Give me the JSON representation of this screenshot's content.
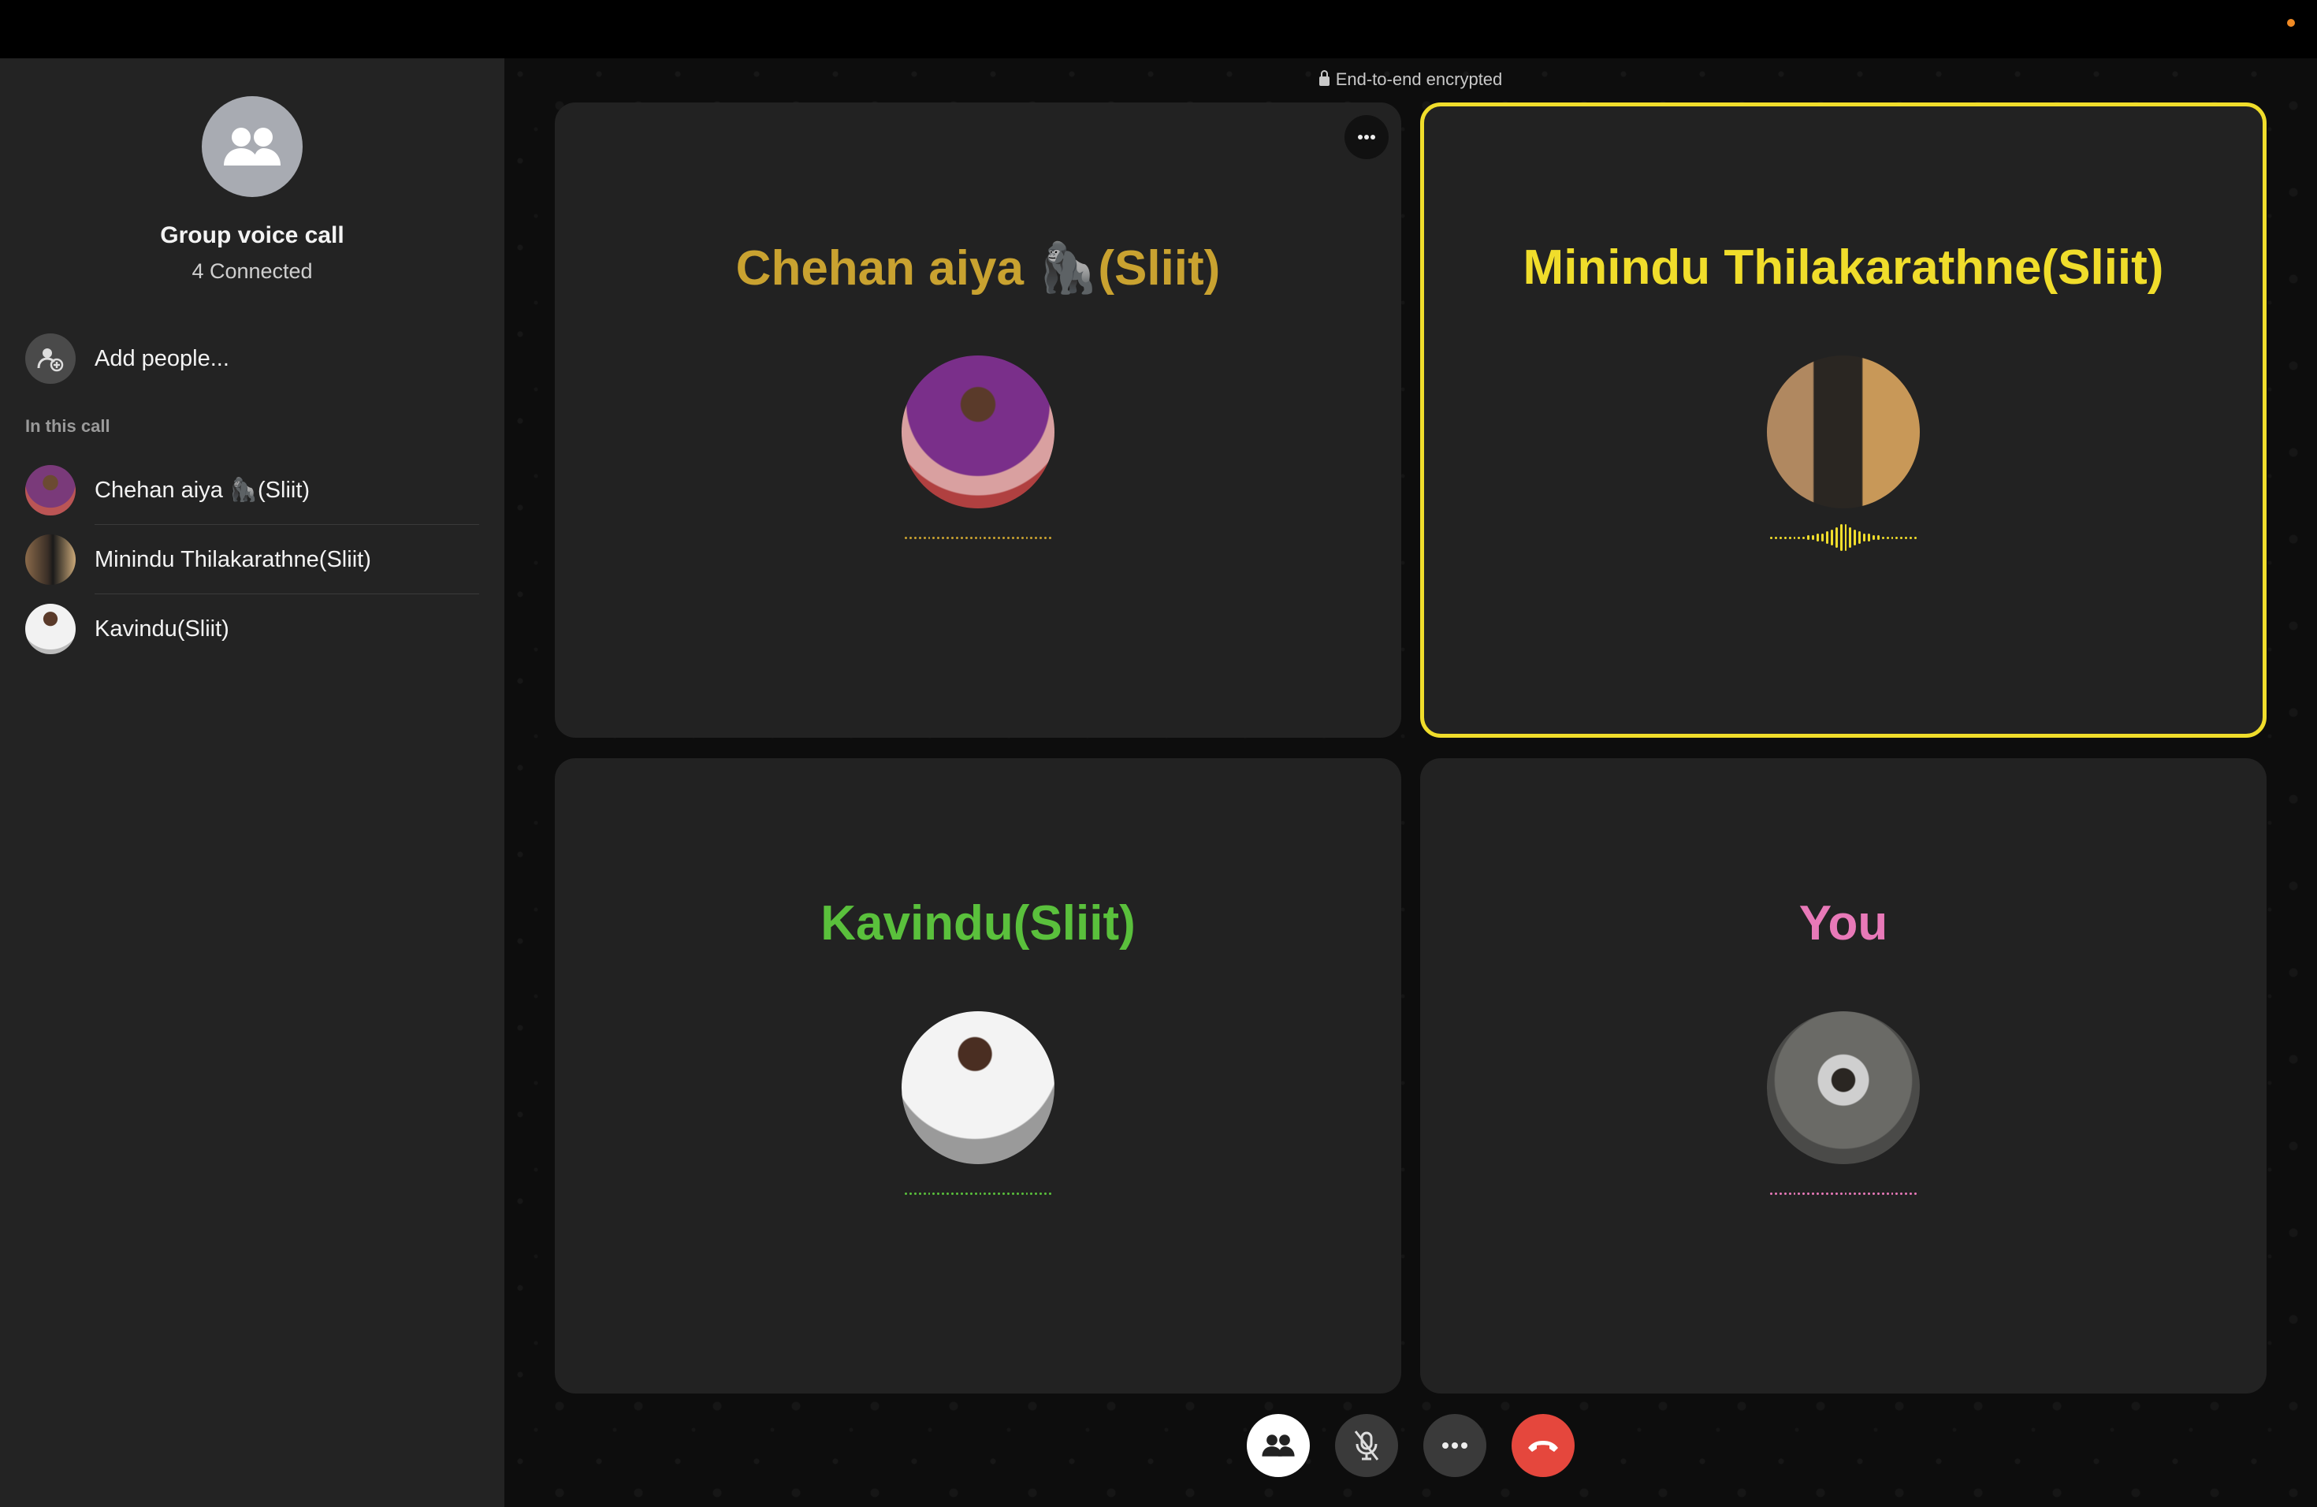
{
  "sidebar": {
    "title": "Group voice call",
    "subtitle": "4 Connected",
    "add_label": "Add people...",
    "section_label": "In this call",
    "participants": [
      {
        "name": "Chehan aiya 🦍(Sliit)",
        "avatar_color": "#7a3a7a"
      },
      {
        "name": "Minindu Thilakarathne(Sliit)",
        "avatar_color": "#5a4030"
      },
      {
        "name": "Kavindu(Sliit)",
        "avatar_color": "#c9c9c9"
      }
    ]
  },
  "main": {
    "encryption": "End-to-end encrypted",
    "tiles": [
      {
        "name": "Chehan aiya 🦍(Sliit)",
        "color": "#c9a230",
        "speaking": false
      },
      {
        "name": "Minindu Thilakarathne(Sliit)",
        "color": "#f0dd2b",
        "speaking": true
      },
      {
        "name": "Kavindu(Sliit)",
        "color": "#5ac03c",
        "speaking": false
      },
      {
        "name": "You",
        "color": "#e879b8",
        "speaking": false
      }
    ]
  },
  "controls": {
    "participants_icon": "people-icon",
    "mute_icon": "mic-off-icon",
    "more_icon": "ellipsis-icon",
    "end_icon": "phone-hangup-icon",
    "end_color": "#e5473d"
  }
}
